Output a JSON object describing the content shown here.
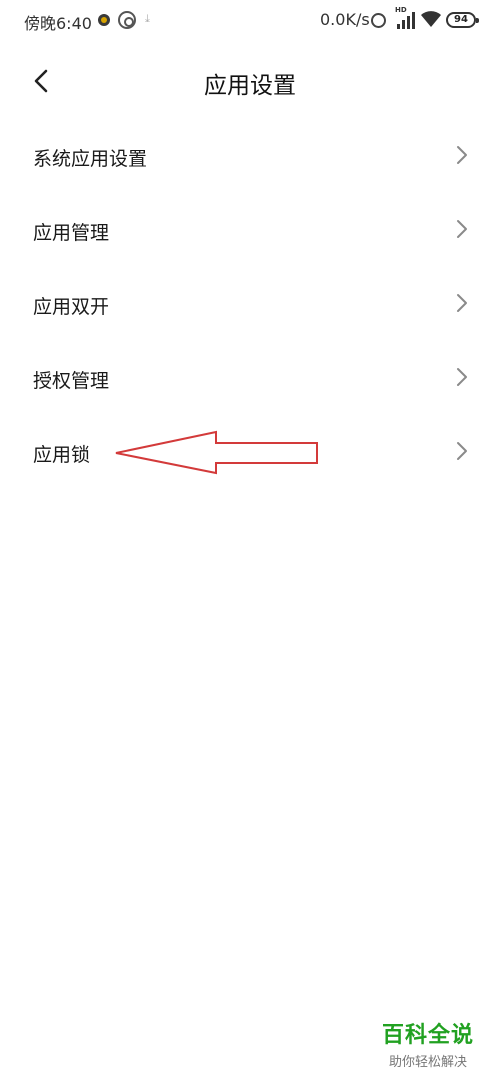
{
  "status_bar": {
    "time": "傍晚6:40",
    "net_speed": "0.0K/s",
    "hd_label": "HD",
    "battery": "94",
    "icons": [
      "notification-icon",
      "hotspot-icon",
      "download-icon",
      "alarm-icon",
      "signal-icon",
      "wifi-icon",
      "battery-icon"
    ]
  },
  "header": {
    "title": "应用设置",
    "back_icon": "chevron-left-icon"
  },
  "settings": {
    "items": [
      {
        "label": "系统应用设置"
      },
      {
        "label": "应用管理"
      },
      {
        "label": "应用双开"
      },
      {
        "label": "授权管理"
      },
      {
        "label": "应用锁"
      }
    ],
    "item_icon": "chevron-right-icon"
  },
  "annotation": {
    "color": "#d33a3a",
    "target": "应用锁"
  },
  "watermark": {
    "title": "百科全说",
    "subtitle": "助你轻松解决",
    "color": "#21a121"
  }
}
